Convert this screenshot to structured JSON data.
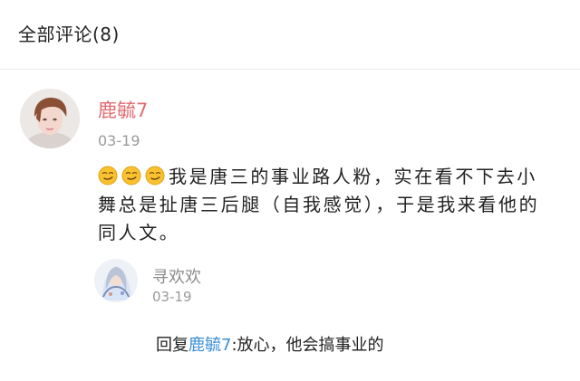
{
  "header": {
    "title": "全部评论(8)"
  },
  "comment": {
    "author": "鹿毓7",
    "date": "03-19",
    "emoji_icon": "smirk-face-icon",
    "emoji_count": 3,
    "text": "我是唐三的事业路人粉，实在看不下去小舞总是扯唐三后腿（自我感觉），于是我来看他的同人文。"
  },
  "reply": {
    "author": "寻欢欢",
    "date": "03-19",
    "prefix": "回复",
    "mention": "鹿毓7",
    "text": ":放心，他会搞事业的"
  },
  "colors": {
    "author_name": "#e26a6f",
    "mention_link": "#3b8fd6",
    "emoji_fill": "#f8c12d"
  }
}
